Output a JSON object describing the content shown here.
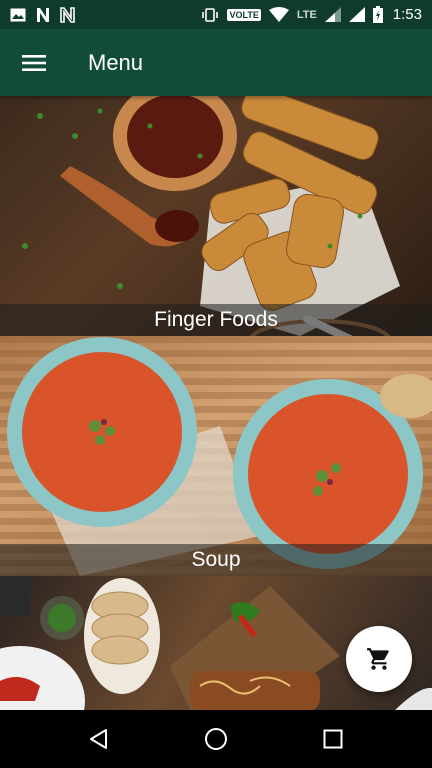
{
  "status_bar": {
    "icons_left": [
      "image-icon",
      "n-icon",
      "n-outline-icon"
    ],
    "volte": "VOLTE",
    "lte": "LTE",
    "time": "1:53"
  },
  "app_bar": {
    "title": "Menu",
    "background": "#114d38"
  },
  "categories": [
    {
      "label": "Finger Foods"
    },
    {
      "label": "Soup"
    },
    {
      "label": ""
    }
  ],
  "fab": {
    "icon": "cart-icon"
  },
  "nav_bar": {
    "buttons": [
      "back-icon",
      "home-icon",
      "recents-icon"
    ]
  },
  "colors": {
    "status_bar": "#0f3b2c",
    "app_bar": "#114d38",
    "fab_bg": "#ffffff"
  }
}
